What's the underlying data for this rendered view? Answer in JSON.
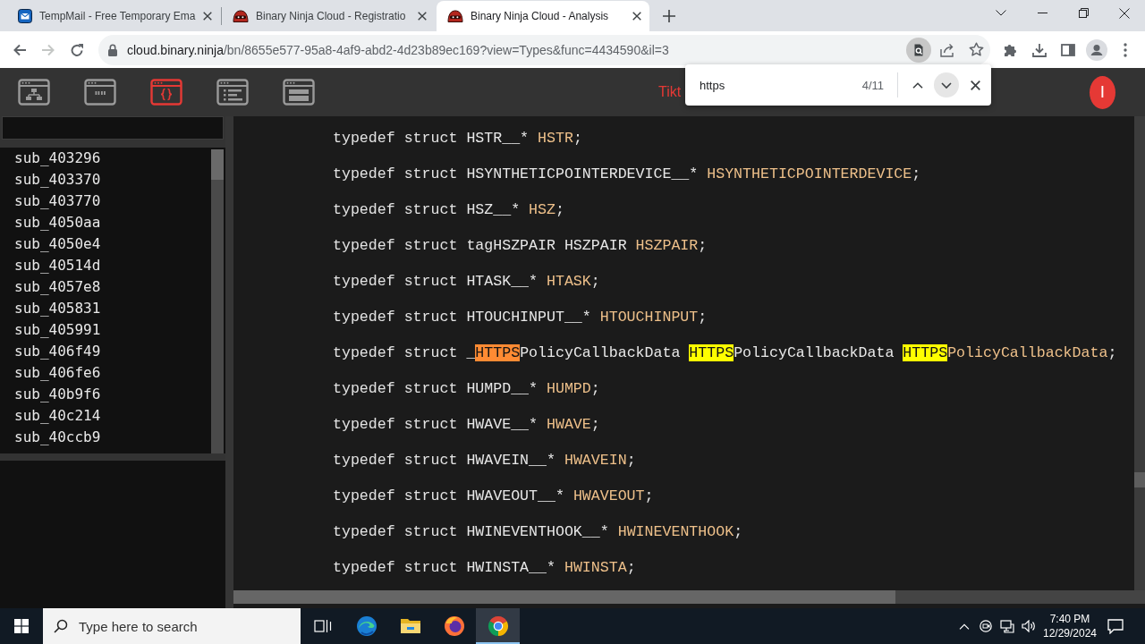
{
  "browser": {
    "tabs": [
      {
        "title": "TempMail - Free Temporary Ema",
        "kind": "mail",
        "selected": false
      },
      {
        "title": "Binary Ninja Cloud - Registratio",
        "kind": "ninja",
        "selected": false
      },
      {
        "title": "Binary Ninja Cloud - Analysis",
        "kind": "ninja",
        "selected": true
      }
    ],
    "nav": [
      {
        "kind": "back",
        "disabled": false
      },
      {
        "kind": "forward",
        "disabled": true
      },
      {
        "kind": "reload",
        "disabled": false
      }
    ],
    "address": {
      "host": "cloud.binary.ninja",
      "path": "/bn/8655e577-95a8-4af9-abd2-4d23b89ec169?view=Types&func=4434590&il=3"
    }
  },
  "find_bar": {
    "query": "https",
    "count": "4/11"
  },
  "app": {
    "views": [
      {
        "kind": "tree",
        "selected": false
      },
      {
        "kind": "quotes",
        "selected": false
      },
      {
        "kind": "braces",
        "selected": true
      },
      {
        "kind": "list",
        "selected": false
      },
      {
        "kind": "blocks",
        "selected": false
      }
    ],
    "title": "Tikt",
    "avatar": "I"
  },
  "sidebar": {
    "functions": [
      "sub_403296",
      "sub_403370",
      "sub_403770",
      "sub_4050aa",
      "sub_4050e4",
      "sub_40514d",
      "sub_4057e8",
      "sub_405831",
      "sub_405991",
      "sub_406f49",
      "sub_406fe6",
      "sub_40b9f6",
      "sub_40c214",
      "sub_40ccb9"
    ]
  },
  "code": {
    "lines": [
      {
        "tokens": [
          {
            "text": "typedef struct ",
            "kind": "keyword"
          },
          {
            "text": "HSTR__* ",
            "kind": "type"
          },
          {
            "text": "HSTR",
            "kind": "name"
          },
          {
            "text": ";",
            "kind": "punct"
          }
        ]
      },
      {
        "tokens": [
          {
            "text": "typedef struct ",
            "kind": "keyword"
          },
          {
            "text": "HSYNTHETICPOINTERDEVICE__* ",
            "kind": "type"
          },
          {
            "text": "HSYNTHETICPOINTERDEVICE",
            "kind": "name"
          },
          {
            "text": ";",
            "kind": "punct"
          }
        ]
      },
      {
        "tokens": [
          {
            "text": "typedef struct ",
            "kind": "keyword"
          },
          {
            "text": "HSZ__* ",
            "kind": "type"
          },
          {
            "text": "HSZ",
            "kind": "name"
          },
          {
            "text": ";",
            "kind": "punct"
          }
        ]
      },
      {
        "tokens": [
          {
            "text": "typedef struct ",
            "kind": "keyword"
          },
          {
            "text": "tagHSZPAIR HSZPAIR ",
            "kind": "type"
          },
          {
            "text": "HSZPAIR",
            "kind": "name"
          },
          {
            "text": ";",
            "kind": "punct"
          }
        ]
      },
      {
        "tokens": [
          {
            "text": "typedef struct ",
            "kind": "keyword"
          },
          {
            "text": "HTASK__* ",
            "kind": "type"
          },
          {
            "text": "HTASK",
            "kind": "name"
          },
          {
            "text": ";",
            "kind": "punct"
          }
        ]
      },
      {
        "tokens": [
          {
            "text": "typedef struct ",
            "kind": "keyword"
          },
          {
            "text": "HTOUCHINPUT__* ",
            "kind": "type"
          },
          {
            "text": "HTOUCHINPUT",
            "kind": "name"
          },
          {
            "text": ";",
            "kind": "punct"
          }
        ]
      },
      {
        "tokens": [
          {
            "text": "typedef struct ",
            "kind": "keyword"
          },
          {
            "text": "_",
            "kind": "type"
          },
          {
            "text": "HTTPS",
            "kind": "match",
            "current": true
          },
          {
            "text": "PolicyCallbackData ",
            "kind": "type"
          },
          {
            "text": "HTTPS",
            "kind": "match",
            "current": false
          },
          {
            "text": "PolicyCallbackData ",
            "kind": "type"
          },
          {
            "text": "HTTPS",
            "kind": "match",
            "current": false
          },
          {
            "text": "PolicyCallbackData",
            "kind": "name"
          },
          {
            "text": ";",
            "kind": "punct"
          }
        ]
      },
      {
        "tokens": [
          {
            "text": "typedef struct ",
            "kind": "keyword"
          },
          {
            "text": "HUMPD__* ",
            "kind": "type"
          },
          {
            "text": "HUMPD",
            "kind": "name"
          },
          {
            "text": ";",
            "kind": "punct"
          }
        ]
      },
      {
        "tokens": [
          {
            "text": "typedef struct ",
            "kind": "keyword"
          },
          {
            "text": "HWAVE__* ",
            "kind": "type"
          },
          {
            "text": "HWAVE",
            "kind": "name"
          },
          {
            "text": ";",
            "kind": "punct"
          }
        ]
      },
      {
        "tokens": [
          {
            "text": "typedef struct ",
            "kind": "keyword"
          },
          {
            "text": "HWAVEIN__* ",
            "kind": "type"
          },
          {
            "text": "HWAVEIN",
            "kind": "name"
          },
          {
            "text": ";",
            "kind": "punct"
          }
        ]
      },
      {
        "tokens": [
          {
            "text": "typedef struct ",
            "kind": "keyword"
          },
          {
            "text": "HWAVEOUT__* ",
            "kind": "type"
          },
          {
            "text": "HWAVEOUT",
            "kind": "name"
          },
          {
            "text": ";",
            "kind": "punct"
          }
        ]
      },
      {
        "tokens": [
          {
            "text": "typedef struct ",
            "kind": "keyword"
          },
          {
            "text": "HWINEVENTHOOK__* ",
            "kind": "type"
          },
          {
            "text": "HWINEVENTHOOK",
            "kind": "name"
          },
          {
            "text": ";",
            "kind": "punct"
          }
        ]
      },
      {
        "tokens": [
          {
            "text": "typedef struct ",
            "kind": "keyword"
          },
          {
            "text": "HWINSTA__* ",
            "kind": "type"
          },
          {
            "text": "HWINSTA",
            "kind": "name"
          },
          {
            "text": ";",
            "kind": "punct"
          }
        ]
      }
    ]
  },
  "taskbar": {
    "search_placeholder": "Type here to search",
    "apps": [
      {
        "kind": "taskview",
        "selected": false
      },
      {
        "kind": "edge",
        "selected": false
      },
      {
        "kind": "explorer",
        "selected": false
      },
      {
        "kind": "firefox",
        "selected": false
      },
      {
        "kind": "chrome",
        "selected": true
      }
    ],
    "time": "7:40 PM",
    "date": "12/29/2024"
  }
}
